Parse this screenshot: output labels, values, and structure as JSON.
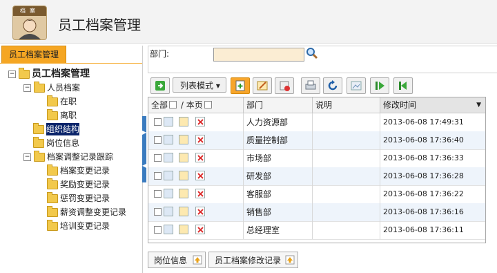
{
  "app": {
    "title": "员工档案管理",
    "logo_text": "档案"
  },
  "left_panel": {
    "tab_label": "员工档案管理",
    "tree": [
      {
        "label": "员工档案管理",
        "toggle": "−",
        "level": 0,
        "bold": true
      },
      {
        "label": "人员档案",
        "toggle": "−",
        "level": 1
      },
      {
        "label": "在职",
        "toggle": "",
        "level": 2
      },
      {
        "label": "离职",
        "toggle": "",
        "level": 2
      },
      {
        "label": "组织结构",
        "toggle": "",
        "level": 1,
        "selected": true
      },
      {
        "label": "岗位信息",
        "toggle": "",
        "level": 1
      },
      {
        "label": "档案调整记录跟踪",
        "toggle": "−",
        "level": 1
      },
      {
        "label": "档案变更记录",
        "toggle": "",
        "level": 2
      },
      {
        "label": "奖励变更记录",
        "toggle": "",
        "level": 2
      },
      {
        "label": "惩罚变更记录",
        "toggle": "",
        "level": 2
      },
      {
        "label": "薪资调整变更记录",
        "toggle": "",
        "level": 2
      },
      {
        "label": "培训变更记录",
        "toggle": "",
        "level": 2
      }
    ]
  },
  "search": {
    "dept_label": "部门:",
    "dept_value": ""
  },
  "toolbar": {
    "list_mode_label": "列表模式",
    "list_mode_arrow": "▾"
  },
  "grid": {
    "header_all": "全部",
    "header_slash": "/",
    "header_page": "本页",
    "columns": [
      "部门",
      "说明",
      "修改时间"
    ],
    "sort_arrow": "▼",
    "rows": [
      {
        "dept": "人力资源部",
        "desc": "",
        "time": "2013-06-08 17:49:31"
      },
      {
        "dept": "质量控制部",
        "desc": "",
        "time": "2013-06-08 17:36:40"
      },
      {
        "dept": "市场部",
        "desc": "",
        "time": "2013-06-08 17:36:33"
      },
      {
        "dept": "研发部",
        "desc": "",
        "time": "2013-06-08 17:36:28"
      },
      {
        "dept": "客服部",
        "desc": "",
        "time": "2013-06-08 17:36:22"
      },
      {
        "dept": "销售部",
        "desc": "",
        "time": "2013-06-08 17:36:16"
      },
      {
        "dept": "总经理室",
        "desc": "",
        "time": "2013-06-08 17:36:11"
      }
    ]
  },
  "bottom_tabs": [
    "岗位信息",
    "员工档案修改记录"
  ],
  "colors": {
    "accent": "#f5a623",
    "selected": "#0a246a",
    "splitter": "#3a7bbf"
  }
}
